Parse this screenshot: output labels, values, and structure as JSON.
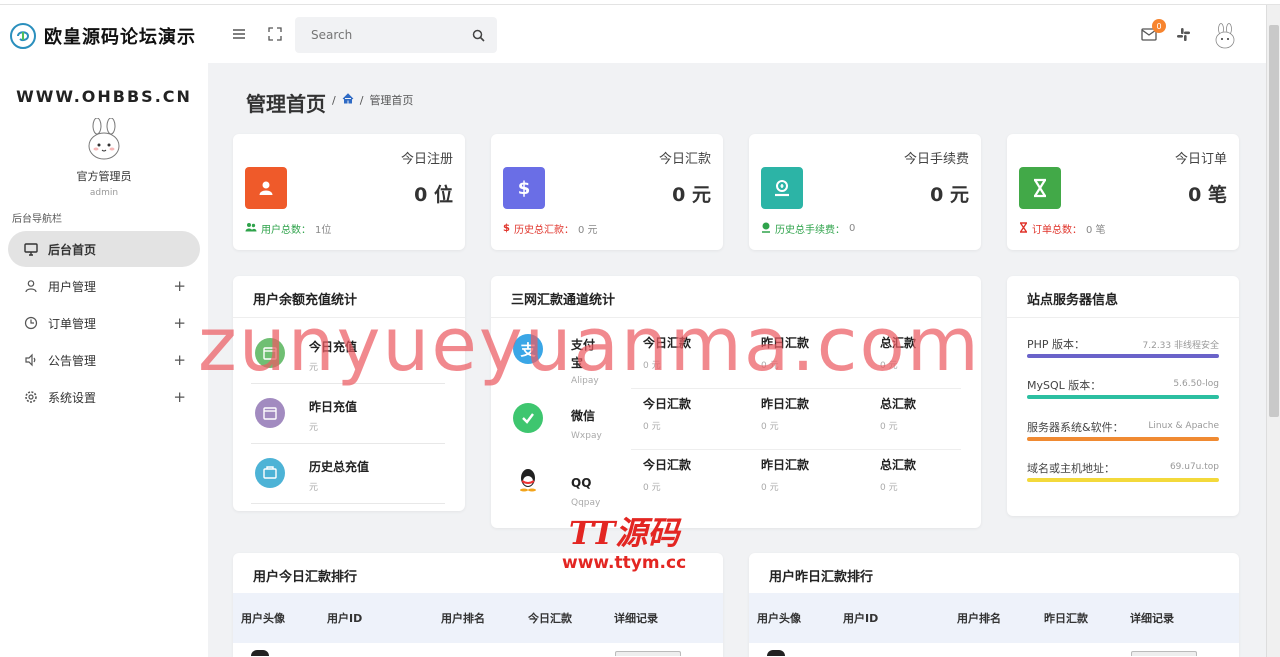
{
  "app": {
    "logo_text": "欧皇源码论坛演示",
    "site_url": "WWW.OHBBS.CN"
  },
  "admin": {
    "name": "官方管理员",
    "role": "admin"
  },
  "sidebar": {
    "nav_title": "后台导航栏",
    "items": [
      {
        "label": "后台首页",
        "icon": "monitor-icon",
        "expandable": false
      },
      {
        "label": "用户管理",
        "icon": "user-icon",
        "expandable": true
      },
      {
        "label": "订单管理",
        "icon": "clock-icon",
        "expandable": true
      },
      {
        "label": "公告管理",
        "icon": "speaker-icon",
        "expandable": true
      },
      {
        "label": "系统设置",
        "icon": "gear-icon",
        "expandable": true
      }
    ],
    "expand_symbol": "+"
  },
  "header": {
    "search_placeholder": "Search",
    "mail_badge": "0"
  },
  "page": {
    "title": "管理首页",
    "breadcrumb_sep": "/",
    "breadcrumb_current": "管理首页"
  },
  "stats": [
    {
      "label": "今日注册",
      "value": "0 位",
      "foot_label": "用户总数：",
      "foot_value": "1位",
      "color": "#ef5a2a",
      "foot_color": "#2fa34b",
      "icon": "user-icon"
    },
    {
      "label": "今日汇款",
      "value": "0 元",
      "foot_label": "历史总汇款：",
      "foot_value": "0 元",
      "color": "#6a6ee6",
      "foot_color": "#e0342b",
      "icon": "dollar-icon"
    },
    {
      "label": "今日手续费",
      "value": "0 元",
      "foot_label": "历史总手续费：",
      "foot_value": "0",
      "color": "#2cb4a6",
      "foot_color": "#2fa34b",
      "icon": "coin-icon"
    },
    {
      "label": "今日订单",
      "value": "0 笔",
      "foot_label": "订单总数：",
      "foot_value": "0 笔",
      "color": "#42a948",
      "foot_color": "#e0342b",
      "icon": "hourglass-icon"
    }
  ],
  "recharge": {
    "title": "用户余额充值统计",
    "rows": [
      {
        "label": "今日充值",
        "value": "元",
        "color": "#6fbf73"
      },
      {
        "label": "昨日充值",
        "value": "元",
        "color": "#a28bc0"
      },
      {
        "label": "历史总充值",
        "value": "元",
        "color": "#4db3d6"
      }
    ]
  },
  "channels": {
    "title": "三网汇款通道统计",
    "col_today": "今日汇款",
    "col_yesterday": "昨日汇款",
    "col_total": "总汇款",
    "rows": [
      {
        "name": "支付宝",
        "sub": "Alipay",
        "today": "0 元",
        "yesterday": "0 元",
        "total": "0 元",
        "icon": "alipay-icon"
      },
      {
        "name": "微信",
        "sub": "Wxpay",
        "today": "0 元",
        "yesterday": "0 元",
        "total": "0 元",
        "icon": "wechat-icon"
      },
      {
        "name": "QQ",
        "sub": "Qqpay",
        "today": "0 元",
        "yesterday": "0 元",
        "total": "0 元",
        "icon": "qq-icon"
      }
    ]
  },
  "server": {
    "title": "站点服务器信息",
    "rows": [
      {
        "key": "PHP 版本：",
        "value": "7.2.33 非线程安全",
        "bar_color": "#6a63c9"
      },
      {
        "key": "MySQL 版本：",
        "value": "5.6.50-log",
        "bar_color": "#2cbfa1"
      },
      {
        "key": "服务器系统&软件：",
        "value": "Linux & Apache",
        "bar_color": "#f08a32"
      },
      {
        "key": "域名或主机地址：",
        "value": "69.u7u.top",
        "bar_color": "#f3d93b"
      }
    ]
  },
  "rank_today": {
    "title": "用户今日汇款排行",
    "cols": [
      "用户头像",
      "用户ID",
      "用户排名",
      "今日汇款",
      "详细记录"
    ]
  },
  "rank_yesterday": {
    "title": "用户昨日汇款排行",
    "cols": [
      "用户头像",
      "用户ID",
      "用户排名",
      "昨日汇款",
      "详细记录"
    ]
  },
  "watermarks": {
    "main": "zunyueyuanma.com",
    "logo_a": "TT源码",
    "logo_b": "www.ttym.cc"
  }
}
